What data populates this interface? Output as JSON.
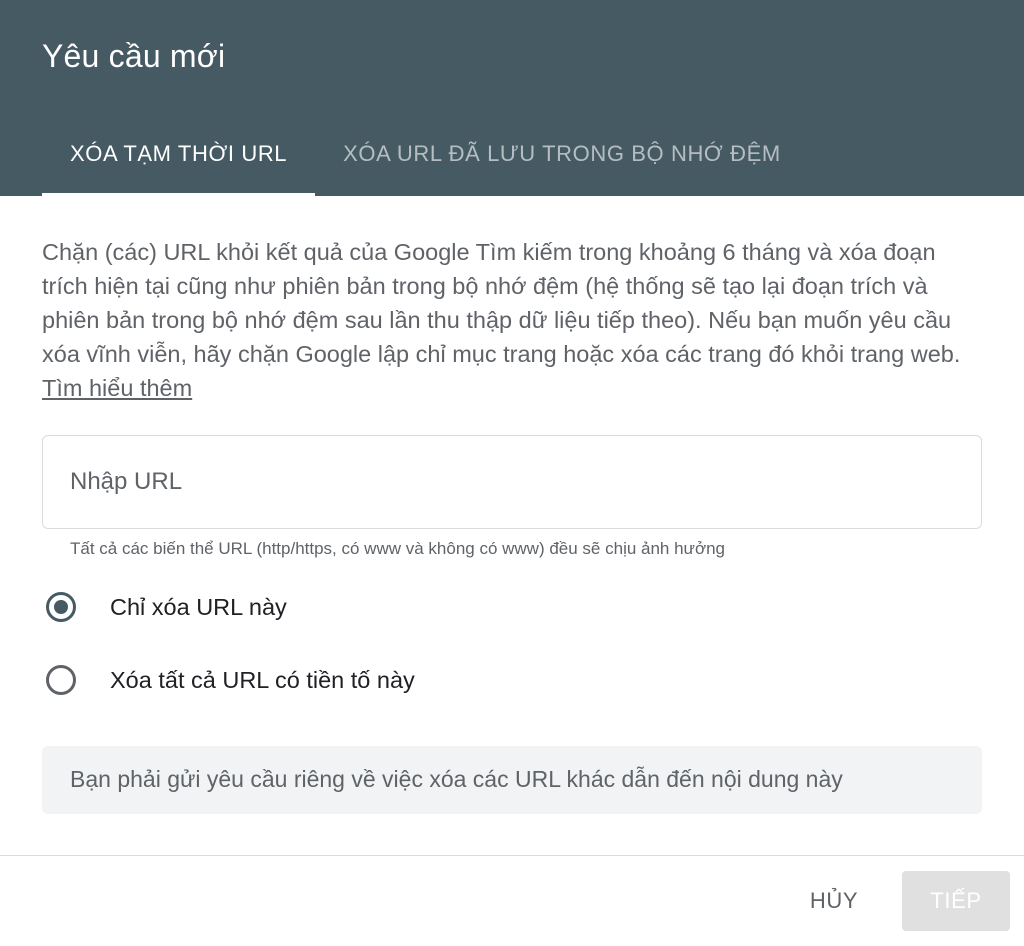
{
  "dialog": {
    "title": "Yêu cầu mới"
  },
  "tabs": [
    {
      "label": "XÓA TẠM THỜI URL",
      "active": true
    },
    {
      "label": "XÓA URL ĐÃ LƯU TRONG BỘ NHỚ ĐỆM",
      "active": false
    }
  ],
  "description": {
    "text": "Chặn (các) URL khỏi kết quả của Google Tìm kiếm trong khoảng 6 tháng và xóa đoạn trích hiện tại cũng như phiên bản trong bộ nhớ đệm (hệ thống sẽ tạo lại đoạn trích và phiên bản trong bộ nhớ đệm sau lần thu thập dữ liệu tiếp theo). Nếu bạn muốn yêu cầu xóa vĩnh viễn, hãy chặn Google lập chỉ mục trang hoặc xóa các trang đó khỏi trang web.",
    "link": "Tìm hiểu thêm"
  },
  "url_input": {
    "placeholder": "Nhập URL",
    "value": "",
    "helper": "Tất cả các biến thể URL (http/https, có www và không có www) đều sẽ chịu ảnh hưởng"
  },
  "options": [
    {
      "label": "Chỉ xóa URL này",
      "checked": true
    },
    {
      "label": "Xóa tất cả URL có tiền tố này",
      "checked": false
    }
  ],
  "notice": "Bạn phải gửi yêu cầu riêng về việc xóa các URL khác dẫn đến nội dung này",
  "actions": {
    "cancel": "HỦY",
    "next": "TIẾP"
  },
  "colors": {
    "header": "#465a64",
    "notice_bg": "#f1f3f4",
    "next_disabled_bg": "#e0e0e0"
  }
}
